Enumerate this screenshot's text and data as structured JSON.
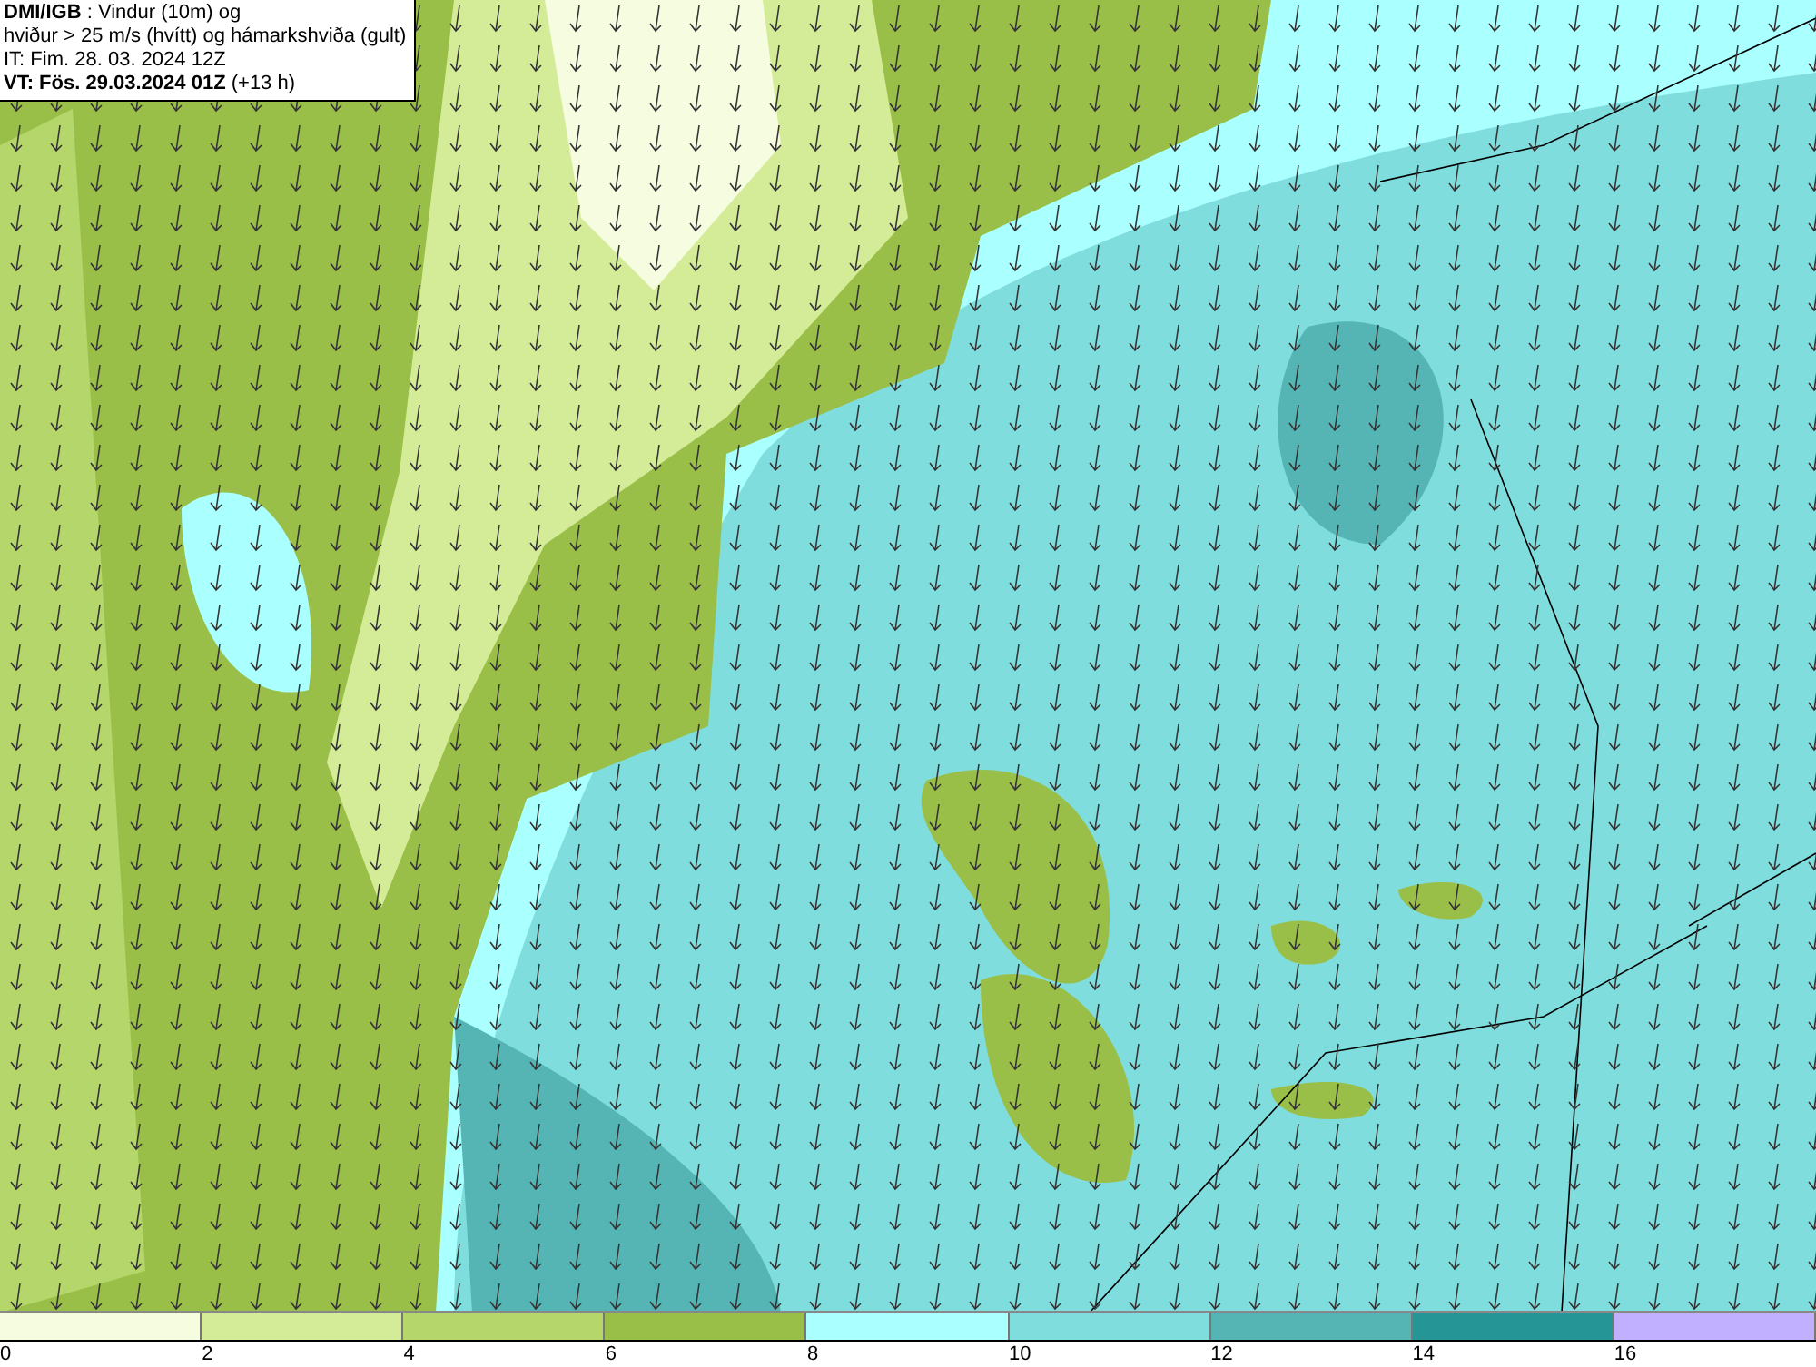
{
  "header": {
    "lines": [
      "**DMI/IGB** : Vindur (10m) og",
      "hviður > 25 m/s (hvítt) og hámarkshviða (gult)",
      "IT: Fim. 28. 03. 2024 12Z",
      "**VT: Fös. 29.03.2024 01Z** (+13 h)"
    ]
  },
  "legend": {
    "swatches": [
      {
        "color": "#f5fce0"
      },
      {
        "color": "#d4eb98"
      },
      {
        "color": "#b5d66a"
      },
      {
        "color": "#99bf48"
      },
      {
        "color": "#aaffff"
      },
      {
        "color": "#80dddd"
      },
      {
        "color": "#55b5b5"
      },
      {
        "color": "#269595"
      },
      {
        "color": "#c0b0ff"
      }
    ],
    "labels": [
      "0",
      "2",
      "4",
      "6",
      "8",
      "10",
      "12",
      "14",
      "16"
    ]
  }
}
